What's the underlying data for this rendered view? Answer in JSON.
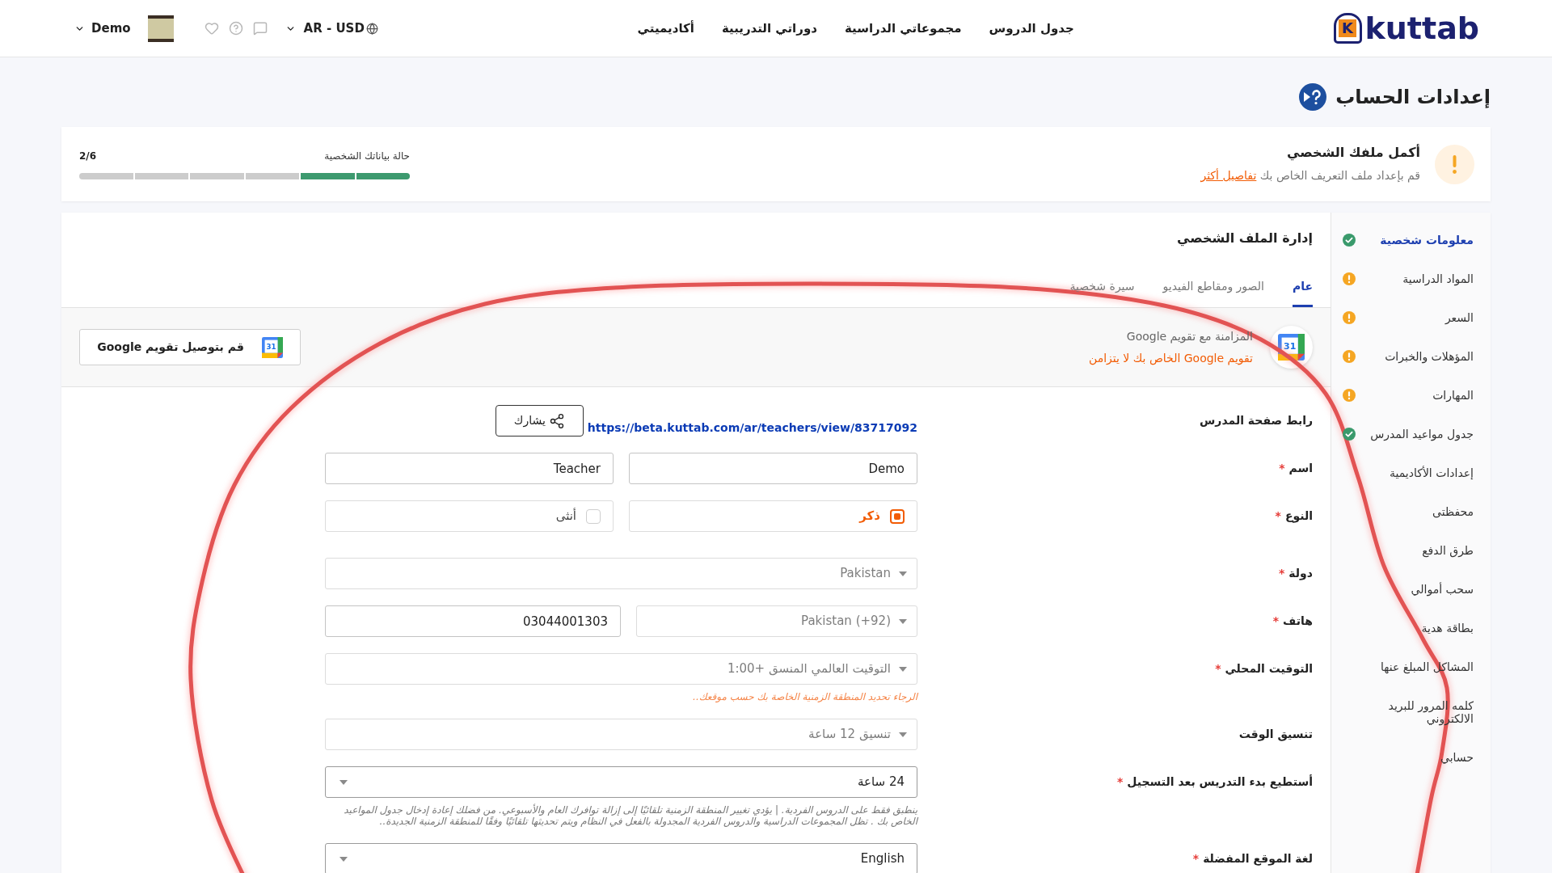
{
  "header": {
    "logo_letter": "K",
    "logo_text": "kuttab",
    "nav": [
      {
        "label": "جدول الدروس"
      },
      {
        "label": "مجموعاتي الدراسية"
      },
      {
        "label": "دوراتي التدريبية"
      },
      {
        "label": "أكاديميتي"
      }
    ],
    "user_name": "Demo",
    "locale": "AR - USD"
  },
  "page_title": "إعدادات الحساب",
  "profile_banner": {
    "title": "أكمل ملفك الشخصي",
    "description": "قم بإعداد ملف التعريف الخاص بك",
    "link": "تفاصيل أكثر",
    "progress_label": "حالة بياناتك الشخصية",
    "progress_count": "2/6",
    "segments": [
      {
        "filled": true
      },
      {
        "filled": true
      },
      {
        "filled": false
      },
      {
        "filled": false
      },
      {
        "filled": false
      },
      {
        "filled": false
      }
    ]
  },
  "sidebar": {
    "items": [
      {
        "label": "معلومات شخصية",
        "selected": true,
        "complete": true
      },
      {
        "label": "المواد الدراسية",
        "selected": false,
        "complete": false
      },
      {
        "label": "السعر",
        "selected": false,
        "complete": false
      },
      {
        "label": "المؤهلات والخبرات",
        "selected": false,
        "complete": false
      },
      {
        "label": "المهارات",
        "selected": false,
        "complete": false
      },
      {
        "label": "جدول مواعيد المدرس",
        "selected": false,
        "complete": true
      },
      {
        "label": "إعدادات الأكاديمية",
        "selected": false
      },
      {
        "label": "محفظتى",
        "selected": false
      },
      {
        "label": "طرق الدفع",
        "selected": false
      },
      {
        "label": "سحب أموالي",
        "selected": false
      },
      {
        "label": "بطاقة هدية",
        "selected": false
      },
      {
        "label": "المشاكل المبلغ عنها",
        "selected": false
      },
      {
        "label": "كلمه المرور للبريد الالكتروني",
        "selected": false
      },
      {
        "label": "حسابي",
        "selected": false
      }
    ]
  },
  "panel": {
    "title": "إدارة الملف الشخصي",
    "tabs": [
      {
        "label": "عام",
        "selected": true
      },
      {
        "label": "الصور ومقاطع الفيديو",
        "selected": false
      },
      {
        "label": "سيرة شخصية",
        "selected": false
      }
    ],
    "calendar_sync": {
      "icon_day": "31",
      "title": "المزامنة مع تقويم Google",
      "status": "تقويم Google الخاص بك لا يتزامن",
      "button": "قم بتوصيل تقويم Google",
      "button_icon_day": "31"
    },
    "form": {
      "rows": [
        {
          "kind": "link",
          "label": "رابط صفحة المدرس",
          "url": "https://beta.kuttab.com/ar/teachers/view/83717092",
          "share_button": "يشارك"
        },
        {
          "kind": "fields",
          "label": "اسم",
          "required_mark": "*",
          "fields": [
            {
              "kind": "input",
              "value": "Demo"
            },
            {
              "kind": "input",
              "value": "Teacher"
            }
          ]
        },
        {
          "kind": "fields",
          "label": "النوع",
          "required_mark": "*",
          "fields": [
            {
              "kind": "radio",
              "label": "ذكر",
              "selected": true
            },
            {
              "kind": "radio",
              "label": "أنثى",
              "selected": false
            }
          ]
        },
        {
          "kind": "fields",
          "label": "دولة",
          "required_mark": "*",
          "fields": [
            {
              "kind": "select",
              "value": "Pakistan",
              "disabled": true
            }
          ]
        },
        {
          "kind": "fields",
          "label": "هاتف",
          "required_mark": "*",
          "fields": [
            {
              "kind": "select",
              "value": "Pakistan (+92)",
              "disabled": true
            },
            {
              "kind": "input",
              "value": "03044001303"
            }
          ]
        },
        {
          "kind": "fields",
          "label": "التوقيت المحلي",
          "required_mark": "*",
          "fields": [
            {
              "kind": "select",
              "value": "التوقيت العالمي المنسق +1:00",
              "disabled": true
            }
          ],
          "hint": {
            "kind": "warning",
            "text": "الرجاء تحديد المنطقة الزمنية الخاصة بك حسب موقعك.."
          }
        },
        {
          "kind": "fields",
          "label": "تنسيق الوقت",
          "fields": [
            {
              "kind": "select",
              "value": "تنسيق 12 ساعة",
              "disabled": true
            }
          ]
        },
        {
          "kind": "fields",
          "label": "أستطيع بدء التدريس بعد التسجيل",
          "required_mark": "*",
          "fields": [
            {
              "kind": "select",
              "value": "24 ساعة",
              "disabled": false
            }
          ],
          "hint": {
            "kind": "note",
            "text": "ينطبق فقط على الدروس الفردية. | يؤدي تغيير المنطقة الزمنية تلقائيًا إلى إزالة توافرك العام والأسبوعي. من فضلك إعادة إدخال جدول المواعيد الخاص بك . تظل المجموعات الدراسية والدروس الفردية المجدولة بالفعل في النظام ويتم تحديثها تلقائيًا وفقًا للمنطقة الزمنية الجديدة.."
          }
        },
        {
          "kind": "fields",
          "label": "لغة الموقع المفضلة",
          "required_mark": "*",
          "fields": [
            {
              "kind": "select",
              "value": "English",
              "disabled": false
            }
          ]
        }
      ]
    }
  }
}
